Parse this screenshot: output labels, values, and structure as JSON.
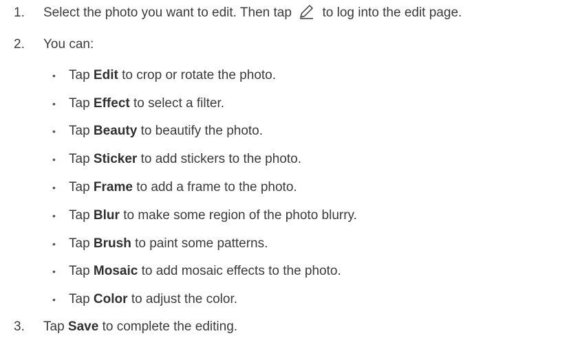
{
  "steps": [
    {
      "number": "1.",
      "text_before_icon": "Select the photo you want to edit. Then tap",
      "icon": "pencil-edit-icon",
      "text_after_icon": "to log into the edit page."
    },
    {
      "number": "2.",
      "text": "You can:"
    },
    {
      "number": "3.",
      "prefix": "Tap",
      "keyword": "Save",
      "suffix": "to complete the editing."
    }
  ],
  "options": [
    {
      "prefix": "Tap",
      "keyword": "Edit",
      "suffix": "to crop or rotate the photo."
    },
    {
      "prefix": "Tap",
      "keyword": "Effect",
      "suffix": "to select a filter."
    },
    {
      "prefix": "Tap",
      "keyword": "Beauty",
      "suffix": "to beautify the photo."
    },
    {
      "prefix": "Tap",
      "keyword": "Sticker",
      "suffix": "to add stickers to the photo."
    },
    {
      "prefix": "Tap",
      "keyword": "Frame",
      "suffix": "to add a frame to the photo."
    },
    {
      "prefix": "Tap",
      "keyword": "Blur",
      "suffix": "to make some region of the photo blurry."
    },
    {
      "prefix": "Tap",
      "keyword": "Brush",
      "suffix": "to paint some patterns."
    },
    {
      "prefix": "Tap",
      "keyword": "Mosaic",
      "suffix": "to add mosaic effects to the photo."
    },
    {
      "prefix": "Tap",
      "keyword": "Color",
      "suffix": "to adjust the color."
    }
  ],
  "bullet_char": "•",
  "colors": {
    "text": "#3a3a3a",
    "background": "#ffffff"
  }
}
